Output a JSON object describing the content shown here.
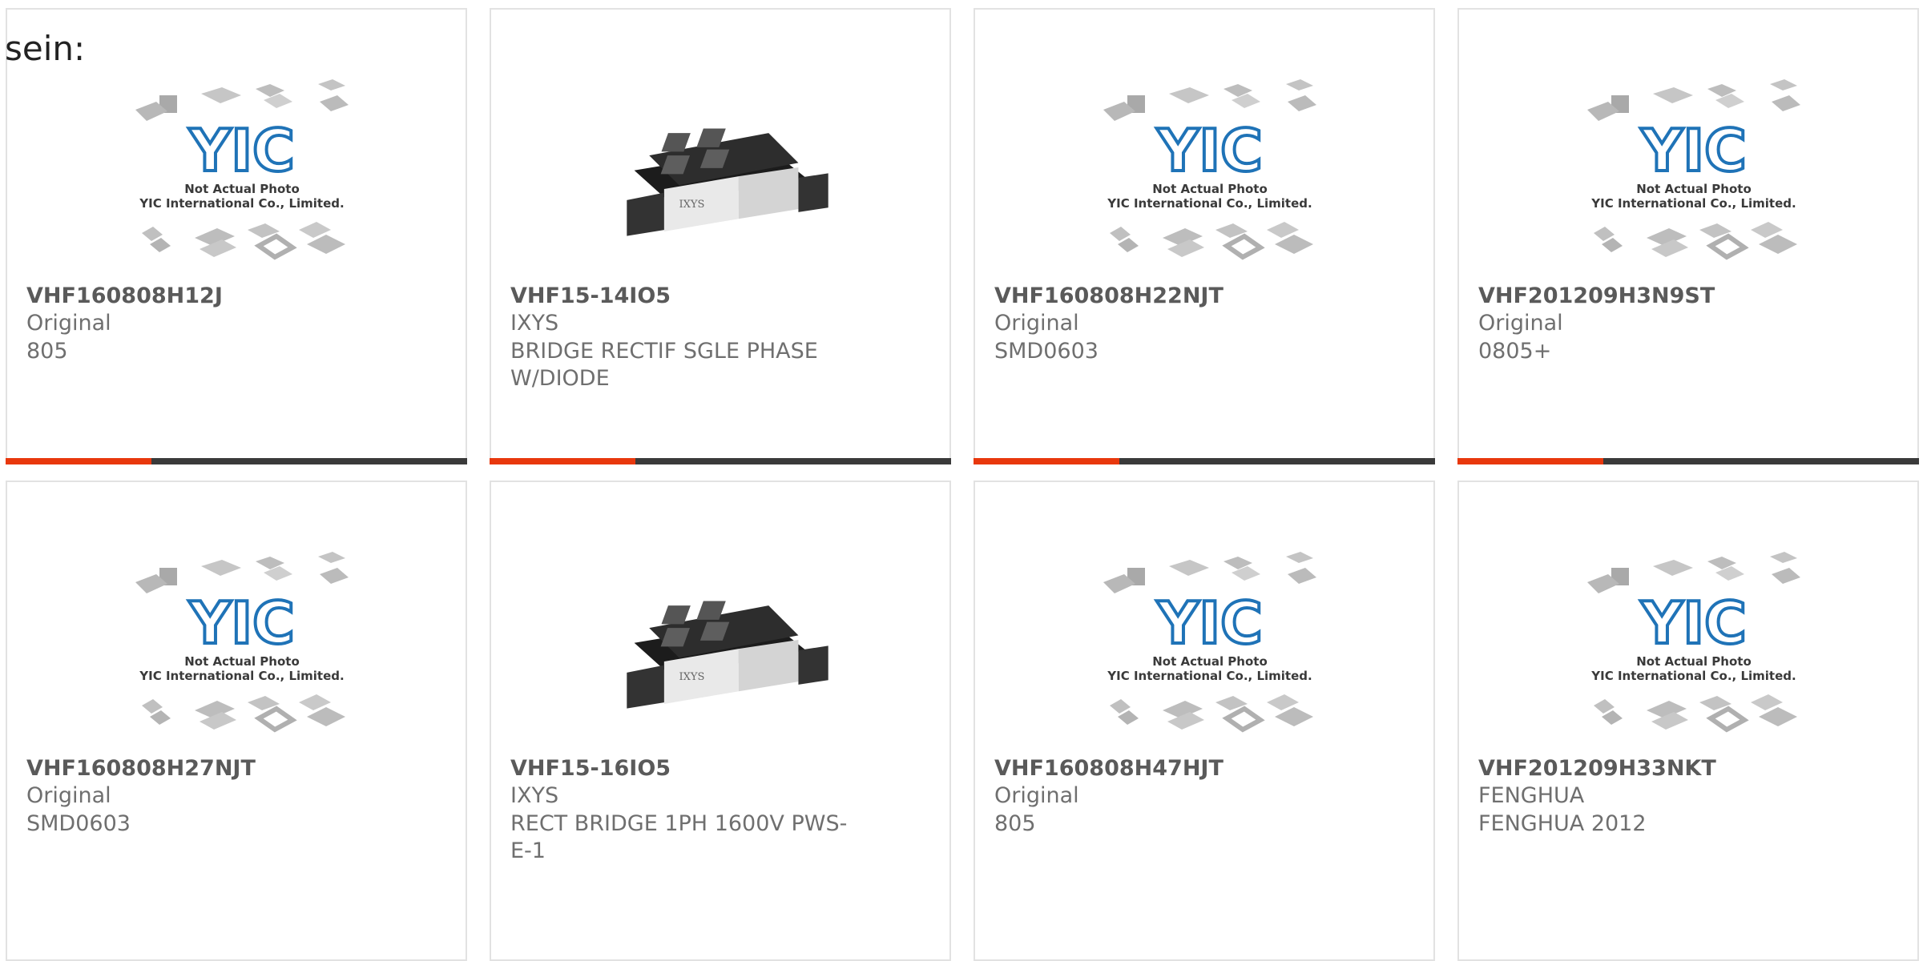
{
  "intro_text": "sein:",
  "placeholder_caption": [
    "Not Actual Photo",
    "YIC International Co., Limited."
  ],
  "brand_logo": "YIC",
  "colors": {
    "accent": "#e8380d",
    "bar": "#3a3a3a",
    "logo": "#1f73b7"
  },
  "products": [
    {
      "part": "VHF160808H12J",
      "maker": "Original",
      "desc": "805",
      "image": "placeholder"
    },
    {
      "part": "VHF15-14IO5",
      "maker": "IXYS",
      "desc": "BRIDGE RECTIF SGLE PHASE W/DIODE",
      "image": "module"
    },
    {
      "part": "VHF160808H22NJT",
      "maker": "Original",
      "desc": "SMD0603",
      "image": "placeholder"
    },
    {
      "part": "VHF201209H3N9ST",
      "maker": "Original",
      "desc": "0805+",
      "image": "placeholder"
    },
    {
      "part": "VHF160808H27NJT",
      "maker": "Original",
      "desc": "SMD0603",
      "image": "placeholder"
    },
    {
      "part": "VHF15-16IO5",
      "maker": "IXYS",
      "desc": "RECT BRIDGE 1PH 1600V PWS-E-1",
      "image": "module"
    },
    {
      "part": "VHF160808H47HJT",
      "maker": "Original",
      "desc": "805",
      "image": "placeholder"
    },
    {
      "part": "VHF201209H33NKT",
      "maker": "FENGHUA",
      "desc": "FENGHUA 2012",
      "image": "placeholder"
    }
  ]
}
